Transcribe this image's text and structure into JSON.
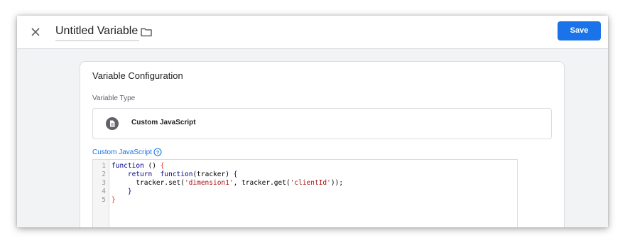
{
  "header": {
    "title": "Untitled Variable",
    "save_label": "Save"
  },
  "card": {
    "title": "Variable Configuration",
    "type_label": "Variable Type",
    "type_name": "Custom JavaScript",
    "js_label": "Custom JavaScript"
  },
  "editor": {
    "line_numbers": [
      "1",
      "2",
      "3",
      "4",
      "5"
    ],
    "lines": [
      "function () {",
      "    return  function(tracker) {",
      "      tracker.set('dimension1', tracker.get('clientId'));",
      "    }",
      "}"
    ]
  },
  "colors": {
    "accent": "#1a73e8",
    "background": "#f1f3f4",
    "keyword": "#000088",
    "string": "#aa1111",
    "brace_highlight": "#e8322f"
  },
  "icons": [
    "close-icon",
    "folder-icon",
    "document-icon",
    "help-icon"
  ]
}
